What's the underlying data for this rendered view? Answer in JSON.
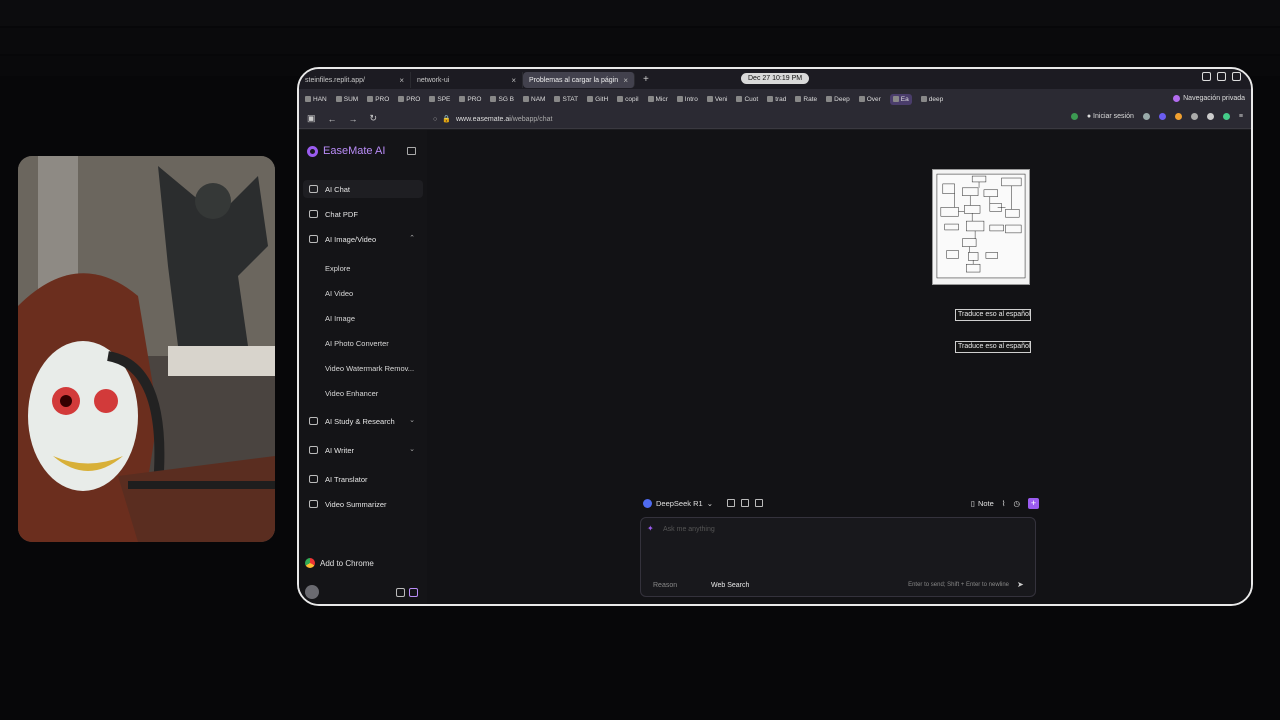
{
  "browser": {
    "tabs": [
      {
        "label": "steinfiles.replit.app/",
        "active": false
      },
      {
        "label": "network-ui",
        "active": false
      },
      {
        "label": "Problemas al cargar la págin",
        "active": true
      }
    ],
    "clock": "Dec 27  10:19 PM",
    "bookmarks": [
      "HAN",
      "SUM",
      "PRO",
      "PRO",
      "SPE",
      "PRO",
      "SG B",
      "NAM",
      "STAT",
      "GitH",
      "copil",
      "Micr",
      "Intro",
      "Veni",
      "Cuot",
      "trad",
      "Rate",
      "Deep",
      "Over",
      "Ea",
      "deep"
    ],
    "private_label": "Navegación privada",
    "url_domain": "www.easemate.ai",
    "url_path": "/webapp/chat",
    "signin_label": "Iniciar sesión"
  },
  "app": {
    "brand": "EaseMate AI",
    "nav": [
      {
        "label": "AI Chat"
      },
      {
        "label": "Chat PDF"
      },
      {
        "label": "AI Image/Video"
      }
    ],
    "subnav": [
      "Explore",
      "AI Video",
      "AI Image",
      "AI Photo Converter",
      "Video Watermark Remov...",
      "Video Enhancer"
    ],
    "nav2": [
      {
        "label": "AI Study & Research"
      },
      {
        "label": "AI Writer"
      },
      {
        "label": "AI Translator"
      },
      {
        "label": "Video Summarizer"
      }
    ],
    "add_to_chrome": "Add to Chrome",
    "messages": [
      "Traduce eso al español",
      "Traduce eso al español"
    ],
    "model": "DeepSeek R1",
    "note_label": "Note",
    "input_placeholder": "Ask me anything",
    "reason_label": "Reason",
    "web_search_label": "Web Search",
    "hint": "Enter to send; Shift + Enter to newline"
  },
  "colors": {
    "accent": "#9b5cf0",
    "brand": "#b98cf7"
  }
}
